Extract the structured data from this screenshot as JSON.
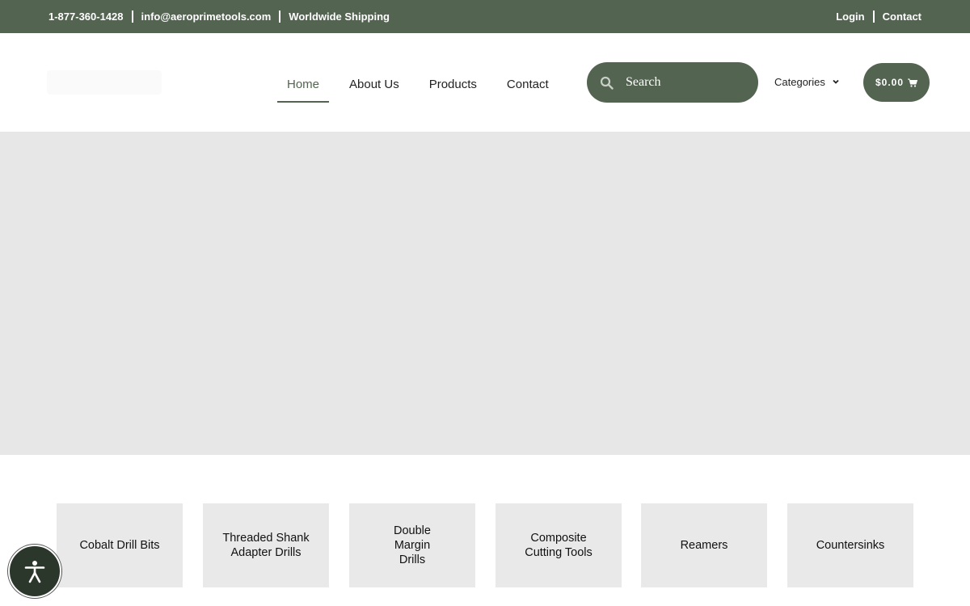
{
  "topbar": {
    "phone": "1-877-360-1428",
    "email": "info@aeroprimetools.com",
    "shipping": "Worldwide Shipping",
    "login": "Login",
    "contact": "Contact"
  },
  "nav": {
    "items": [
      {
        "label": "Home",
        "active": true
      },
      {
        "label": "About Us",
        "active": false
      },
      {
        "label": "Products",
        "active": false
      },
      {
        "label": "Contact",
        "active": false
      }
    ]
  },
  "search": {
    "placeholder": "Search",
    "icon": "search-icon"
  },
  "categories_menu": {
    "label": "Categories",
    "icon": "chevron-down-icon"
  },
  "cart": {
    "total": "$0.00",
    "icon": "shopping-cart-icon"
  },
  "category_tiles": [
    {
      "label": "Cobalt Drill Bits"
    },
    {
      "label": "Threaded Shank\nAdapter Drills"
    },
    {
      "label": "Double\nMargin\nDrills"
    },
    {
      "label": "Composite\nCutting Tools"
    },
    {
      "label": "Reamers"
    },
    {
      "label": "Countersinks"
    }
  ],
  "accessibility": {
    "icon": "accessibility-icon"
  },
  "colors": {
    "brand": "#536451",
    "hero_placeholder": "#e7e7e7",
    "tile_bg": "#e9e9e9",
    "a11y_bg": "#2c372c"
  }
}
